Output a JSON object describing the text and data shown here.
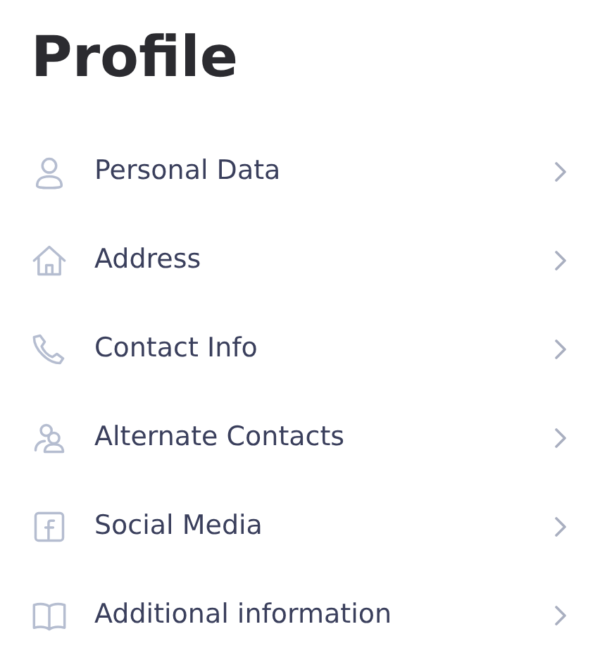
{
  "title": "Profile",
  "items": [
    {
      "kind": "person",
      "label": "Personal Data"
    },
    {
      "kind": "home",
      "label": "Address"
    },
    {
      "kind": "phone",
      "label": "Contact Info"
    },
    {
      "kind": "people",
      "label": "Alternate Contacts"
    },
    {
      "kind": "social",
      "label": "Social Media"
    },
    {
      "kind": "book",
      "label": "Additional information"
    }
  ]
}
